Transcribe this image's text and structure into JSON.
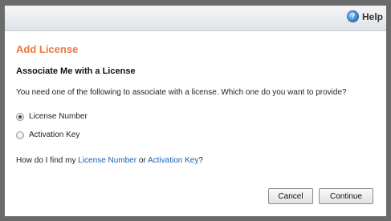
{
  "toolbar": {
    "help_label": "Help",
    "help_icon": "help-icon"
  },
  "dialog": {
    "title": "Add License",
    "subtitle": "Associate Me with a License",
    "prompt": "You need one of the following to associate with a license. Which one do you want to provide?",
    "options": [
      {
        "label": "License Number",
        "selected": true
      },
      {
        "label": "Activation Key",
        "selected": false
      }
    ],
    "howto": {
      "prefix": "How do I find my ",
      "link1": "License Number",
      "middle": " or ",
      "link2": "Activation Key",
      "suffix": "?"
    },
    "buttons": {
      "cancel": "Cancel",
      "continue": "Continue"
    }
  },
  "colors": {
    "title": "#e8793f",
    "link": "#1a5fb4"
  }
}
